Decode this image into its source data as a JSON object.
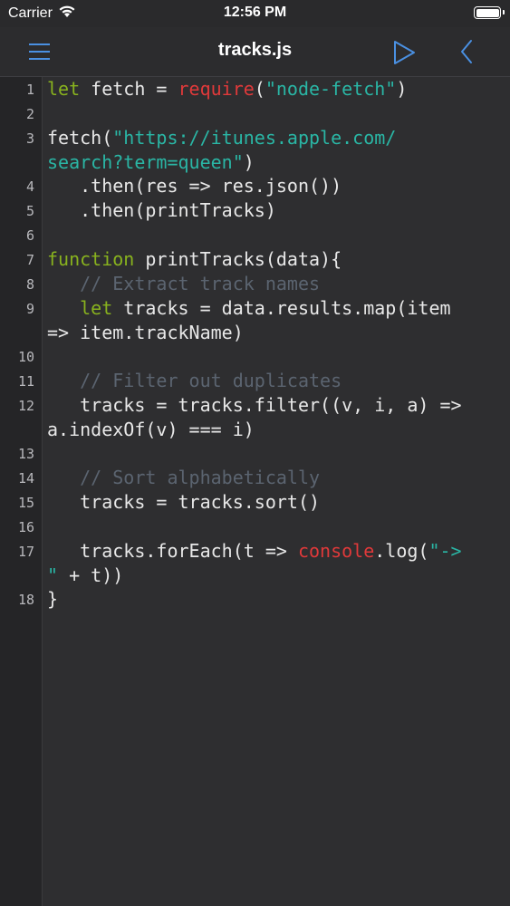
{
  "status_bar": {
    "carrier": "Carrier",
    "time": "12:56 PM"
  },
  "nav": {
    "title": "tracks.js",
    "icons": {
      "menu": "hamburger-menu-icon",
      "run": "play-icon",
      "back": "chevron-left-icon"
    }
  },
  "colors": {
    "background": "#2e2e30",
    "gutter": "#252527",
    "keyword": "#88b21e",
    "string": "#2ab6a5",
    "builtin": "#e0393a",
    "comment": "#5b6470",
    "accent": "#4a90e2"
  },
  "editor": {
    "lines": [
      {
        "number": "1",
        "rows": [
          [
            [
              "kw",
              "let"
            ],
            [
              "tx",
              " fetch = "
            ],
            [
              "red",
              "require"
            ],
            [
              "tx",
              "("
            ],
            [
              "str",
              "\"node-fetch\""
            ],
            [
              "tx",
              ")"
            ]
          ]
        ]
      },
      {
        "number": "2",
        "rows": [
          []
        ]
      },
      {
        "number": "3",
        "rows": [
          [
            [
              "tx",
              "fetch("
            ],
            [
              "str",
              "\"https://itunes.apple.com/"
            ]
          ],
          [
            [
              "str",
              "search?term=queen\""
            ],
            [
              "tx",
              ")"
            ]
          ]
        ]
      },
      {
        "number": "4",
        "rows": [
          [
            [
              "tx",
              "   .then(res => res.json())"
            ]
          ]
        ]
      },
      {
        "number": "5",
        "rows": [
          [
            [
              "tx",
              "   .then(printTracks)"
            ]
          ]
        ]
      },
      {
        "number": "6",
        "rows": [
          []
        ]
      },
      {
        "number": "7",
        "rows": [
          [
            [
              "kw",
              "function"
            ],
            [
              "tx",
              " printTracks(data){"
            ]
          ]
        ]
      },
      {
        "number": "8",
        "rows": [
          [
            [
              "tx",
              "   "
            ],
            [
              "cm",
              "// Extract track names"
            ]
          ]
        ]
      },
      {
        "number": "9",
        "rows": [
          [
            [
              "tx",
              "   "
            ],
            [
              "kw",
              "let"
            ],
            [
              "tx",
              " tracks = data.results.map(item"
            ]
          ],
          [
            [
              "tx",
              "=> item.trackName)"
            ]
          ]
        ]
      },
      {
        "number": "10",
        "rows": [
          []
        ]
      },
      {
        "number": "11",
        "rows": [
          [
            [
              "tx",
              "   "
            ],
            [
              "cm",
              "// Filter out duplicates"
            ]
          ]
        ]
      },
      {
        "number": "12",
        "rows": [
          [
            [
              "tx",
              "   tracks = tracks.filter((v, i, a) =>"
            ]
          ],
          [
            [
              "tx",
              "a.indexOf(v) === i)"
            ]
          ]
        ]
      },
      {
        "number": "13",
        "rows": [
          []
        ]
      },
      {
        "number": "14",
        "rows": [
          [
            [
              "tx",
              "   "
            ],
            [
              "cm",
              "// Sort alphabetically"
            ]
          ]
        ]
      },
      {
        "number": "15",
        "rows": [
          [
            [
              "tx",
              "   tracks = tracks.sort()"
            ]
          ]
        ]
      },
      {
        "number": "16",
        "rows": [
          []
        ]
      },
      {
        "number": "17",
        "rows": [
          [
            [
              "tx",
              "   tracks.forEach(t => "
            ],
            [
              "red",
              "console"
            ],
            [
              "tx",
              ".log("
            ],
            [
              "str",
              "\"->"
            ]
          ],
          [
            [
              "str",
              "\""
            ],
            [
              "tx",
              " + t))"
            ]
          ]
        ]
      },
      {
        "number": "18",
        "rows": [
          [
            [
              "tx",
              "}"
            ]
          ]
        ]
      }
    ]
  }
}
